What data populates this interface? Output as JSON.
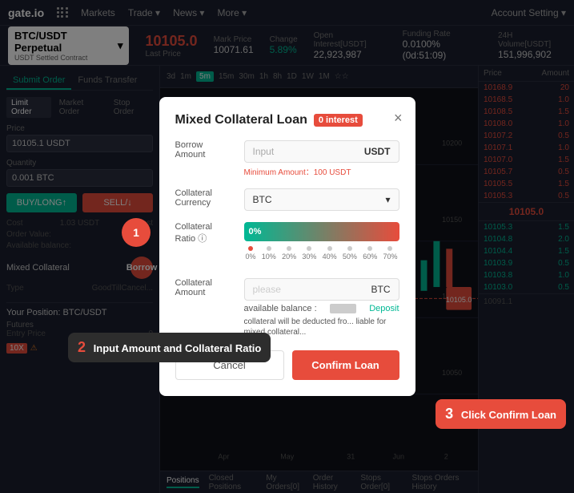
{
  "nav": {
    "logo": "gate.io",
    "items": [
      "Markets",
      "Trade ▾",
      "News ▾",
      "More ▾"
    ],
    "account": "Account Setting ▾"
  },
  "ticker": {
    "symbol": "BTC/USDT Perpetual",
    "sub": "USDT Settled Contract",
    "last_price": "10105.0",
    "last_price_label": "Last Price",
    "mark_price_label": "Mark Price",
    "mark_price": "10071.61",
    "change_label": "Change",
    "change": "5.89%",
    "open_interest_label": "Open Interest[USDT]",
    "open_interest": "22,923,987",
    "funding_rate_label": "Funding Rate",
    "funding_rate": "0.0100%(0d:51:09)",
    "volume_label": "24H Volume[USDT]",
    "volume": "151,996,902"
  },
  "left_panel": {
    "tabs": [
      "Submit Order",
      "Funds Transfer"
    ],
    "order_types": [
      "Limit Order",
      "Market Order",
      "Stop Order"
    ],
    "price_label": "Price",
    "price_value": "10105.1 USDT",
    "quantity_label": "Quantity",
    "quantity_value": "0.001 BTC",
    "buy_btn": "BUY/LONG↑",
    "sell_btn": "SELL/↓",
    "cost_label": "Cost",
    "cost_buy": "1.03 USDT",
    "cost_sell": "",
    "order_value_label": "Order Value:",
    "available_balance_label": "Available balance:",
    "mixed_collateral_label": "Mixed Collateral",
    "borrow_label": "Borrow",
    "type_label": "Type",
    "type_value": "GoodTillCancel..."
  },
  "orderbook": {
    "header": [
      "Price",
      "Amount"
    ],
    "sells": [
      [
        "10168.9",
        "20"
      ],
      [
        "10168.5",
        "1.0"
      ],
      [
        "10108.5",
        "1.5"
      ],
      [
        "10108.0",
        "1.0"
      ],
      [
        "10107.2",
        "0.5"
      ],
      [
        "10107.1",
        "1.0"
      ],
      [
        "10107.0",
        "1.5"
      ],
      [
        "10105.7",
        "0.5"
      ],
      [
        "10105.5",
        "1.5"
      ],
      [
        "10105.3",
        "0.5"
      ]
    ],
    "mid_price": "10105.0",
    "buys": [
      [
        "10105.3",
        "1.5"
      ],
      [
        "10104.8",
        "2.0"
      ],
      [
        "10104.4",
        "1.5"
      ],
      [
        "10103.9",
        "0.5"
      ],
      [
        "10103.8",
        "1.0"
      ],
      [
        "10103.0",
        "0.5"
      ]
    ]
  },
  "chart": {
    "timeframes": [
      "3d",
      "1m",
      "5m",
      "15m",
      "30m",
      "1h",
      "8h",
      "1D",
      "1W",
      "1M",
      "☆☆"
    ],
    "active_tf": "5m"
  },
  "positions_bar": {
    "tabs": [
      "Positions",
      "Closed Positions",
      "My Orders[0]",
      "Order History",
      "Stops Order[0]",
      "Stops Orders History"
    ],
    "active_tab": "Positions"
  },
  "your_position": {
    "label": "Your Position: BTC/USDT",
    "type": "Futures",
    "entry_price_label": "Entry Price",
    "entry_price": "0",
    "leverage": "10X"
  },
  "modal": {
    "title": "Mixed Collateral Loan",
    "interest_badge": "0 interest",
    "close_label": "×",
    "borrow_label": "Borrow\nAmount",
    "input_placeholder": "Input",
    "input_suffix": "USDT",
    "min_amount": "Minimum Amount：100 USDT",
    "collateral_currency_label": "Collateral\nCurrency",
    "currency_value": "BTC",
    "collateral_ratio_label": "Collateral\nRatio ⓘ",
    "ratio_pct": "0%",
    "ratio_ticks": [
      "0%",
      "10%",
      "20%",
      "30%",
      "40%",
      "50%",
      "60%",
      "70%"
    ],
    "collateral_amount_label": "Collateral\nAmount",
    "amount_placeholder": "please",
    "amount_suffix": "BTC",
    "available_label": "available balance :",
    "available_value": "■■■■■",
    "deposit_label": "Deposit",
    "cancel_btn": "Cancel",
    "confirm_btn": "Confirm Loan"
  },
  "annotations": {
    "step1_label": "1",
    "step2_label": "2",
    "step2_text": "Input Amount and\nCollateral Ratio",
    "step3_label": "3",
    "step3_text": "Click Confirm Loan"
  }
}
